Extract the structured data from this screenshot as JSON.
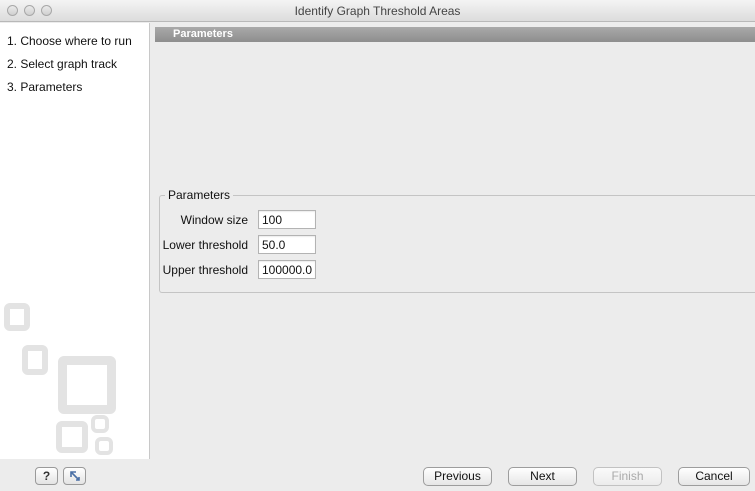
{
  "window": {
    "title": "Identify Graph Threshold Areas"
  },
  "sidebar": {
    "steps": [
      {
        "label": "1.  Choose where to run"
      },
      {
        "label": "2.  Select graph track"
      },
      {
        "label": "3.  Parameters"
      }
    ]
  },
  "main": {
    "section_title": "Parameters",
    "group": {
      "title": "Parameters",
      "fields": [
        {
          "label": "Window size",
          "value": "100"
        },
        {
          "label": "Lower threshold",
          "value": "50.0"
        },
        {
          "label": "Upper threshold",
          "value": "100000.0"
        }
      ]
    }
  },
  "footer": {
    "help_label": "?",
    "previous_label": "Previous",
    "next_label": "Next",
    "finish_label": "Finish",
    "cancel_label": "Cancel"
  },
  "icons": {
    "help": "help-icon",
    "restore": "restore-defaults-icon"
  }
}
